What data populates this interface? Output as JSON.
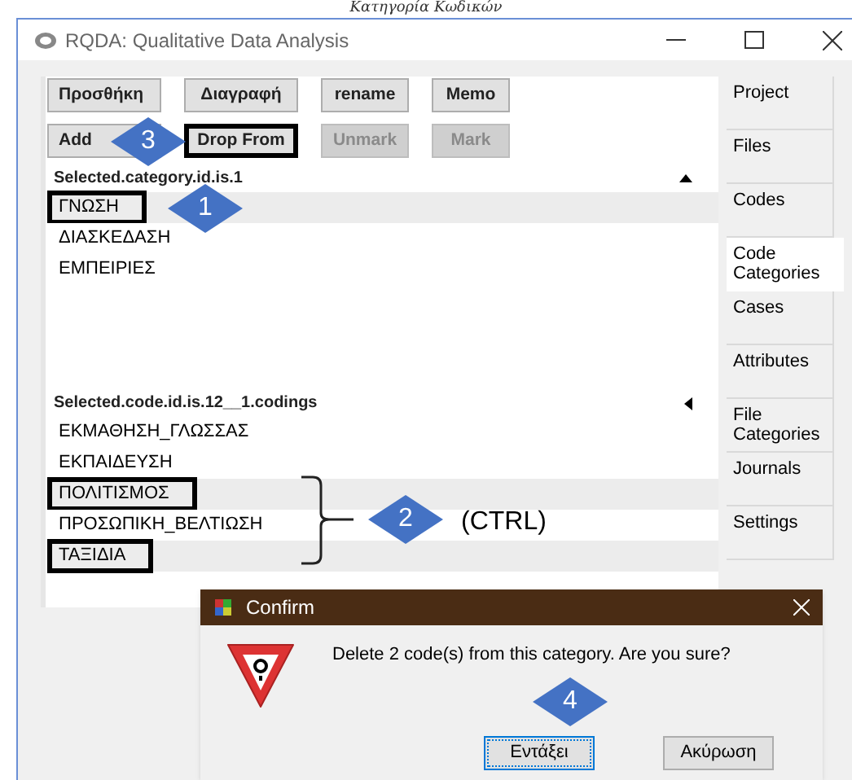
{
  "caption": "Κατηγορία Κωδικών",
  "window": {
    "title": "RQDA: Qualitative Data Analysis"
  },
  "button_rows": [
    [
      {
        "label": "Προσθήκη",
        "disabled": false,
        "outlined": false
      },
      {
        "label": "Διαγραφή",
        "disabled": false,
        "outlined": false
      },
      {
        "label": "rename",
        "disabled": false,
        "outlined": false
      },
      {
        "label": "Memo",
        "disabled": false,
        "outlined": false
      }
    ],
    [
      {
        "label": "Add",
        "disabled": false,
        "outlined": false
      },
      {
        "label": "Drop From",
        "disabled": false,
        "outlined": true
      },
      {
        "label": "Unmark",
        "disabled": true,
        "outlined": false
      },
      {
        "label": "Mark",
        "disabled": true,
        "outlined": false
      }
    ]
  ],
  "category_list": {
    "header": "Selected.category.id.is.1",
    "items": [
      {
        "label": "ΓΝΩΣΗ",
        "selected": true,
        "outlined": true
      },
      {
        "label": "ΔΙΑΣΚΕΔΑΣΗ",
        "selected": false,
        "outlined": false
      },
      {
        "label": "ΕΜΠΕΙΡΙΕΣ",
        "selected": false,
        "outlined": false
      }
    ]
  },
  "code_list": {
    "header": "Selected.code.id.is.12__1.codings",
    "items": [
      {
        "label": "ΕΚΜΑΘΗΣΗ_ΓΛΩΣΣΑΣ",
        "selected": false,
        "outlined": false
      },
      {
        "label": "ΕΚΠΑΙΔΕΥΣΗ",
        "selected": false,
        "outlined": false
      },
      {
        "label": "ΠΟΛΙΤΙΣΜΟΣ",
        "selected": true,
        "outlined": true
      },
      {
        "label": "ΠΡΟΣΩΠΙΚΗ_ΒΕΛΤΙΩΣΗ",
        "selected": false,
        "outlined": false
      },
      {
        "label": "ΤΑΞΙΔΙΑ",
        "selected": true,
        "outlined": true
      }
    ]
  },
  "tabs": [
    {
      "label": "Project",
      "selected": false
    },
    {
      "label": "Files",
      "selected": false
    },
    {
      "label": "Codes",
      "selected": false
    },
    {
      "label": "Code Categories",
      "selected": true
    },
    {
      "label": "Cases",
      "selected": false
    },
    {
      "label": "Attributes",
      "selected": false
    },
    {
      "label": "File Categories",
      "selected": false
    },
    {
      "label": "Journals",
      "selected": false
    },
    {
      "label": "Settings",
      "selected": false
    }
  ],
  "dialog": {
    "title": "Confirm",
    "message": "Delete 2 code(s) from this category. Are you sure?",
    "buttons": [
      {
        "label": "Εντάξει",
        "focused": true
      },
      {
        "label": "Ακύρωση",
        "focused": false
      }
    ]
  },
  "annotations": [
    {
      "number": "3"
    },
    {
      "number": "1"
    },
    {
      "number": "2",
      "note": "(CTRL)"
    },
    {
      "number": "4"
    }
  ]
}
